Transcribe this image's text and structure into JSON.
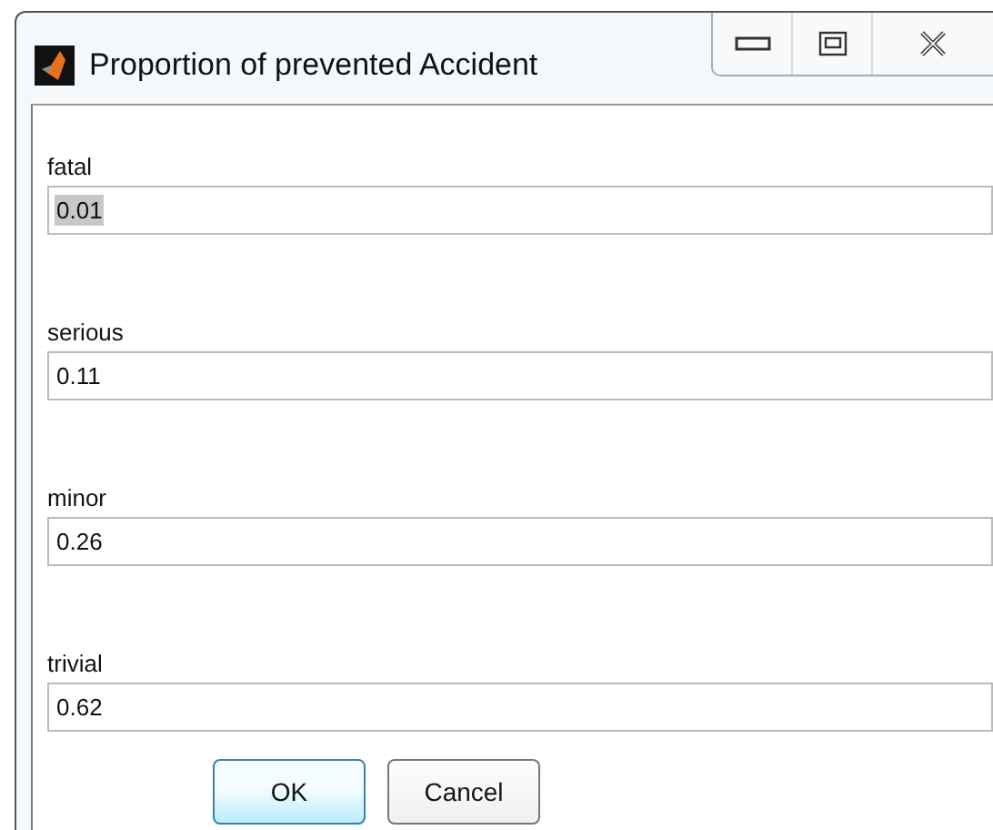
{
  "window": {
    "title": "Proportion of prevented Accident"
  },
  "fields": [
    {
      "label": "fatal",
      "value": "0.01",
      "text_selected": true
    },
    {
      "label": "serious",
      "value": "0.11",
      "text_selected": false
    },
    {
      "label": "minor",
      "value": "0.26",
      "text_selected": false
    },
    {
      "label": "trivial",
      "value": "0.62",
      "text_selected": false
    }
  ],
  "buttons": [
    {
      "label": "OK",
      "kind": "default"
    },
    {
      "label": "Cancel",
      "kind": "normal"
    }
  ]
}
